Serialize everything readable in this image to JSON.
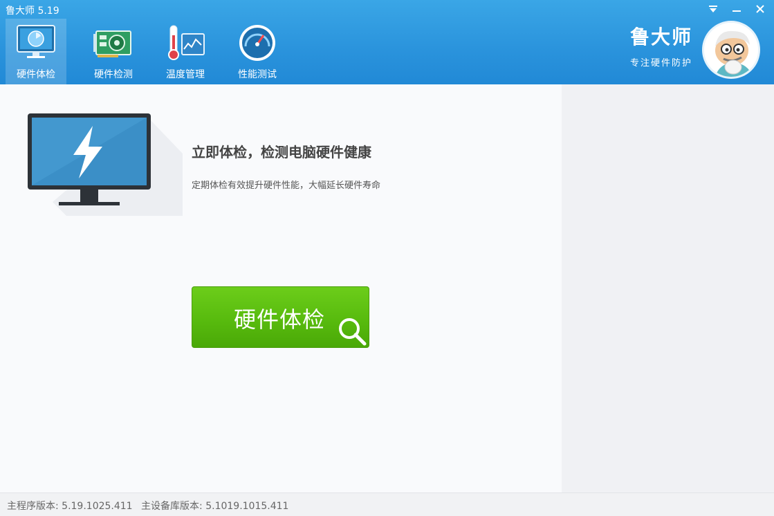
{
  "window": {
    "title": "鲁大师 5.19",
    "controls": {
      "menu": "▼",
      "minimize": "—",
      "close": "✕"
    }
  },
  "tabs": [
    {
      "label": "硬件体检",
      "icon": "monitor-icon",
      "active": true
    },
    {
      "label": "硬件检测",
      "icon": "graphics-card-icon",
      "active": false
    },
    {
      "label": "温度管理",
      "icon": "thermometer-icon",
      "active": false
    },
    {
      "label": "性能测试",
      "icon": "speedometer-icon",
      "active": false
    }
  ],
  "brand": {
    "name": "鲁大师",
    "slogan": "专注硬件防护"
  },
  "main": {
    "headline": "立即体检，检测电脑硬件健康",
    "subline": "定期体检有效提升硬件性能，大幅延长硬件寿命",
    "check_button": "硬件体检"
  },
  "footer": {
    "main_version": "主程序版本: 5.19.1025.411",
    "db_version": "主设备库版本: 5.1019.1015.411"
  },
  "colors": {
    "header": "#2a93dc",
    "button_green": "#58bb0e",
    "background": "#f9fafc"
  }
}
